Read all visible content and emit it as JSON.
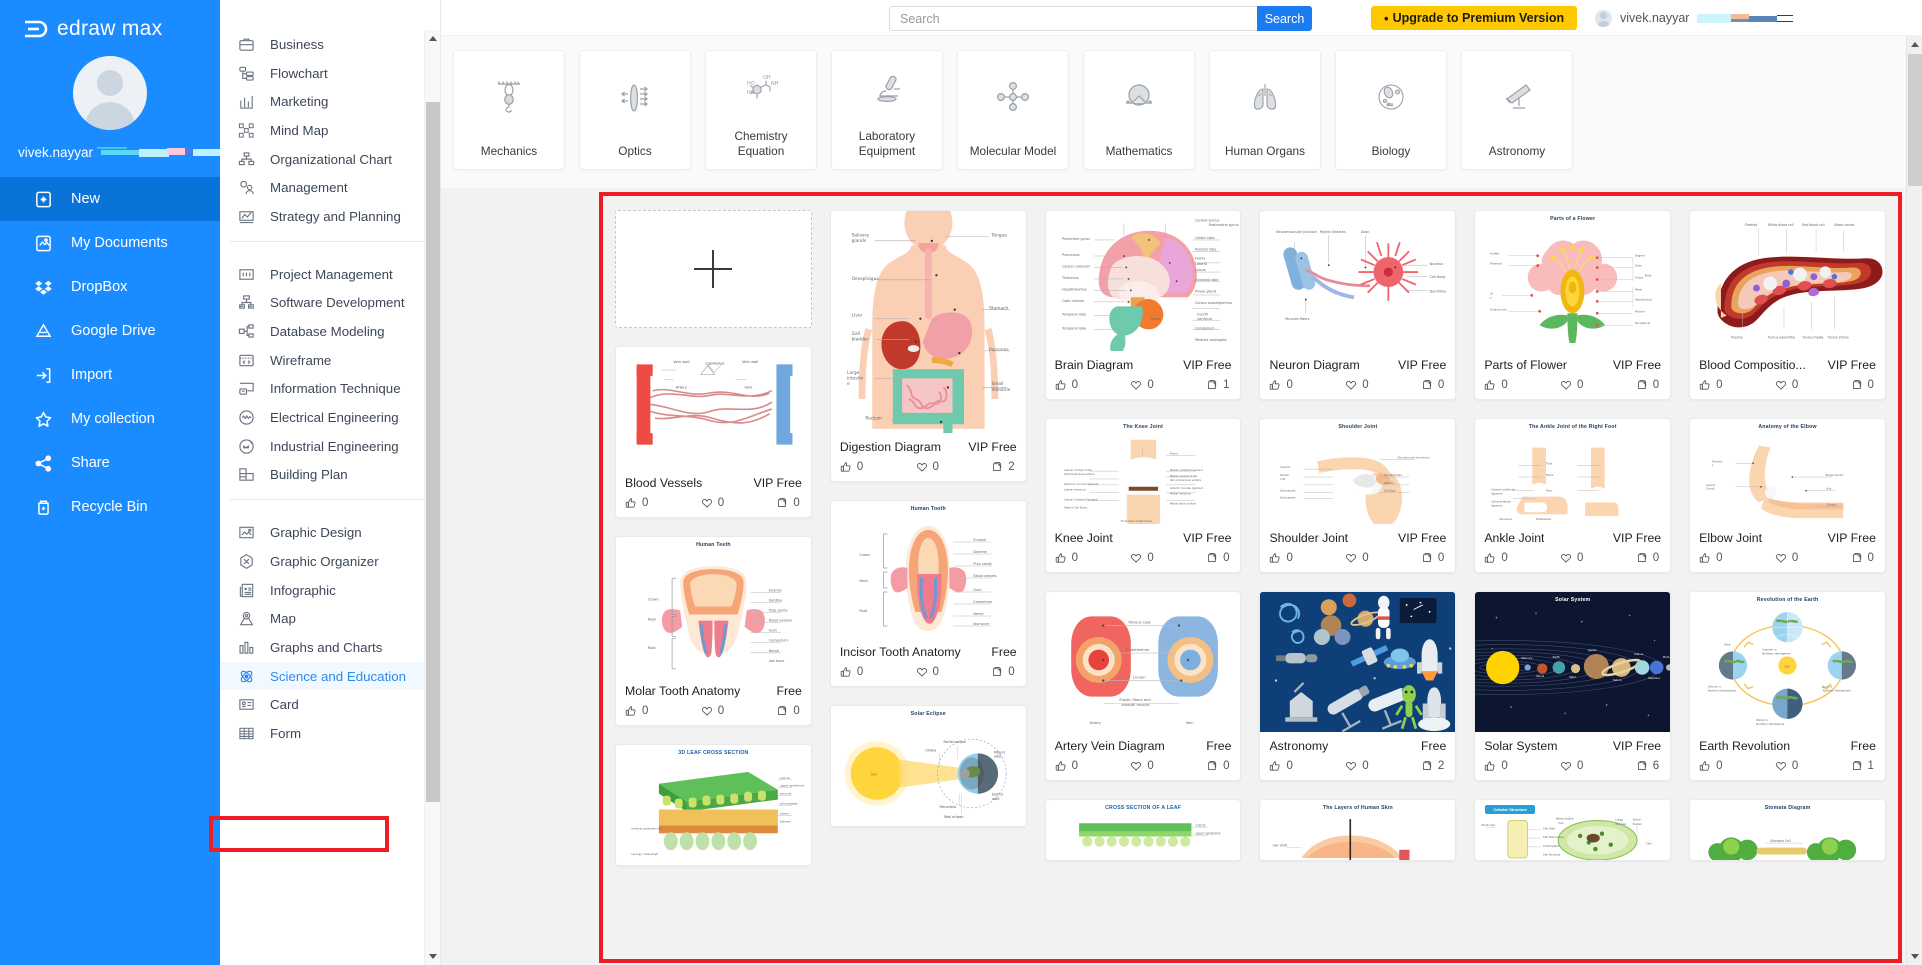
{
  "app": {
    "brand": "edraw max"
  },
  "sidebar": {
    "username": "vivek.nayyar",
    "items": [
      {
        "label": "New",
        "icon": "new-document-icon",
        "active": true
      },
      {
        "label": "My Documents",
        "icon": "documents-icon",
        "active": false
      },
      {
        "label": "DropBox",
        "icon": "dropbox-icon",
        "active": false
      },
      {
        "label": "Google Drive",
        "icon": "google-drive-icon",
        "active": false
      },
      {
        "label": "Import",
        "icon": "import-icon",
        "active": false
      },
      {
        "label": "My collection",
        "icon": "star-icon",
        "active": false
      },
      {
        "label": "Share",
        "icon": "share-icon",
        "active": false
      },
      {
        "label": "Recycle Bin",
        "icon": "trash-icon",
        "active": false
      }
    ]
  },
  "categories": {
    "groups": [
      [
        {
          "label": "Business",
          "icon": "briefcase-icon"
        },
        {
          "label": "Flowchart",
          "icon": "flowchart-icon"
        },
        {
          "label": "Marketing",
          "icon": "bar-chart-icon"
        },
        {
          "label": "Mind Map",
          "icon": "mindmap-icon"
        },
        {
          "label": "Organizational Chart",
          "icon": "org-chart-icon"
        },
        {
          "label": "Management",
          "icon": "management-icon"
        },
        {
          "label": "Strategy and Planning",
          "icon": "trend-line-icon"
        }
      ],
      [
        {
          "label": "Project Management",
          "icon": "project-icon"
        },
        {
          "label": "Software Development",
          "icon": "software-icon"
        },
        {
          "label": "Database Modeling",
          "icon": "database-icon"
        },
        {
          "label": "Wireframe",
          "icon": "wireframe-icon"
        },
        {
          "label": "Information Technique",
          "icon": "infotech-icon"
        },
        {
          "label": "Electrical Engineering",
          "icon": "electrical-icon"
        },
        {
          "label": "Industrial Engineering",
          "icon": "industrial-icon"
        },
        {
          "label": "Building Plan",
          "icon": "building-icon"
        }
      ],
      [
        {
          "label": "Graphic Design",
          "icon": "image-icon"
        },
        {
          "label": "Graphic Organizer",
          "icon": "hexagon-icon"
        },
        {
          "label": "Infographic",
          "icon": "infographic-icon"
        },
        {
          "label": "Map",
          "icon": "map-pin-icon"
        },
        {
          "label": "Graphs and Charts",
          "icon": "graphs-icon"
        },
        {
          "label": "Science and Education",
          "icon": "atom-icon",
          "selected": true
        },
        {
          "label": "Card",
          "icon": "card-icon"
        },
        {
          "label": "Form",
          "icon": "table-icon"
        }
      ]
    ]
  },
  "topbar": {
    "search_placeholder": "Search",
    "search_value": "",
    "search_button": "Search",
    "upgrade_label": "Upgrade to Premium Version",
    "upgrade_bullet": "•",
    "account_name": "vivek.nayyar",
    "accent_blue": "#1a7cf0",
    "upgrade_yellow": "#ffc800",
    "highlight_red": "#ee1c24"
  },
  "subcategories": [
    {
      "label": "Mechanics",
      "icon": "pulley-icon"
    },
    {
      "label": "Optics",
      "icon": "lens-icon"
    },
    {
      "label": "Chemistry Equation",
      "icon": "molecule-chain-icon"
    },
    {
      "label": "Laboratory Equipment",
      "icon": "microscope-icon"
    },
    {
      "label": "Molecular Model",
      "icon": "molecular-model-icon"
    },
    {
      "label": "Mathematics",
      "icon": "geometry-icon"
    },
    {
      "label": "Human Organs",
      "icon": "lungs-icon"
    },
    {
      "label": "Biology",
      "icon": "cell-icon"
    },
    {
      "label": "Astronomy",
      "icon": "telescope-icon"
    }
  ],
  "templates": {
    "new_card_label": "+",
    "columns": [
      [
        {
          "type": "new"
        },
        {
          "name": "Blood Vessels",
          "price": "VIP Free",
          "likes": "0",
          "favorites": "0",
          "copies": "0",
          "art": "blood-vessels",
          "thumb_h": 122
        },
        {
          "name": "Molar Tooth Anatomy",
          "price": "Free",
          "likes": "0",
          "favorites": "0",
          "copies": "0",
          "art": "molar-tooth",
          "title": "Human Teeth",
          "thumb_h": 140
        },
        {
          "name": "",
          "price": "",
          "likes": "",
          "favorites": "",
          "copies": "",
          "art": "leaf-3d",
          "title": "3D LEAF CROSS SECTION",
          "thumb_h": 120,
          "partial": true
        }
      ],
      [
        {
          "name": "Digestion Diagram",
          "price": "VIP Free",
          "likes": "0",
          "favorites": "0",
          "copies": "2",
          "art": "digestion",
          "thumb_h": 222
        },
        {
          "name": "Incisor Tooth Anatomy",
          "price": "Free",
          "likes": "0",
          "favorites": "0",
          "copies": "0",
          "art": "incisor-tooth",
          "title": "Human Tooth",
          "thumb_h": 137
        },
        {
          "name": "",
          "price": "",
          "likes": "",
          "favorites": "",
          "copies": "",
          "art": "solar-eclipse",
          "title": "Solar Eclipse",
          "thumb_h": 120,
          "partial": true
        }
      ],
      [
        {
          "name": "Brain Diagram",
          "price": "VIP Free",
          "likes": "0",
          "favorites": "0",
          "copies": "1",
          "art": "brain",
          "thumb_h": 140
        },
        {
          "name": "Knee Joint",
          "price": "VIP Free",
          "likes": "0",
          "favorites": "0",
          "copies": "0",
          "art": "knee-joint",
          "title": "The Knee Joint",
          "thumb_h": 105
        },
        {
          "name": "Artery Vein Diagram",
          "price": "Free",
          "likes": "0",
          "favorites": "0",
          "copies": "0",
          "art": "artery-vein",
          "thumb_h": 140
        },
        {
          "name": "",
          "price": "",
          "likes": "",
          "favorites": "",
          "copies": "",
          "art": "leaf-cross",
          "title": "CROSS SECTION OF A LEAF",
          "thumb_h": 60,
          "partial": true
        }
      ],
      [
        {
          "name": "Neuron Diagram",
          "price": "VIP Free",
          "likes": "0",
          "favorites": "0",
          "copies": "0",
          "art": "neuron",
          "thumb_h": 140
        },
        {
          "name": "Shoulder Joint",
          "price": "VIP Free",
          "likes": "0",
          "favorites": "0",
          "copies": "0",
          "art": "shoulder-joint",
          "title": "Shoulder Joint",
          "thumb_h": 105
        },
        {
          "name": "Astronomy",
          "price": "Free",
          "likes": "0",
          "favorites": "0",
          "copies": "2",
          "art": "astronomy",
          "thumb_h": 140
        },
        {
          "name": "",
          "price": "",
          "likes": "",
          "favorites": "",
          "copies": "",
          "art": "skin-layers",
          "title": "The Layers of Human Skin",
          "thumb_h": 60,
          "partial": true
        }
      ],
      [
        {
          "name": "Parts of Flower",
          "price": "VIP Free",
          "likes": "0",
          "favorites": "0",
          "copies": "0",
          "art": "flower",
          "title": "Parts of a Flower",
          "thumb_h": 140
        },
        {
          "name": "Ankle Joint",
          "price": "VIP Free",
          "likes": "0",
          "favorites": "0",
          "copies": "0",
          "art": "ankle-joint",
          "title": "The Ankle Joint of the Right Foot",
          "thumb_h": 105
        },
        {
          "name": "Solar System",
          "price": "VIP Free",
          "likes": "0",
          "favorites": "0",
          "copies": "6",
          "art": "solar-system",
          "title": "Solar System",
          "thumb_h": 140
        },
        {
          "name": "",
          "price": "",
          "likes": "",
          "favorites": "",
          "copies": "",
          "art": "cell-structure",
          "title": "Cellular Structure",
          "thumb_h": 60,
          "partial": true
        }
      ],
      [
        {
          "name": "Blood Compositio...",
          "price": "VIP Free",
          "likes": "0",
          "favorites": "0",
          "copies": "0",
          "art": "blood-composition",
          "thumb_h": 140
        },
        {
          "name": "Elbow Joint",
          "price": "VIP Free",
          "likes": "0",
          "favorites": "0",
          "copies": "0",
          "art": "elbow-joint",
          "title": "Anatomy of the Elbow",
          "thumb_h": 105
        },
        {
          "name": "Earth Revolution",
          "price": "Free",
          "likes": "0",
          "favorites": "0",
          "copies": "1",
          "art": "earth-revolution",
          "title": "Revolution of the Earth",
          "thumb_h": 140
        },
        {
          "name": "",
          "price": "",
          "likes": "",
          "favorites": "",
          "copies": "",
          "art": "stomata",
          "title": "Stomata Diagram",
          "thumb_h": 60,
          "partial": true
        }
      ]
    ]
  }
}
